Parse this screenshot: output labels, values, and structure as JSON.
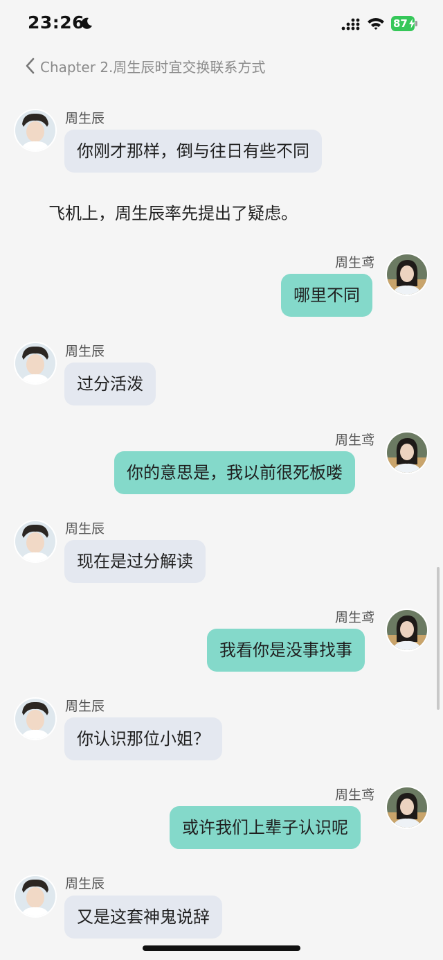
{
  "status_bar": {
    "time": "23:26",
    "battery": "87"
  },
  "nav": {
    "title": "Chapter 2.周生辰时宜交换联系方式"
  },
  "chat": {
    "narration": "飞机上，周生辰率先提出了疑虑。",
    "messages": [
      {
        "sender": "周生辰",
        "side": "left",
        "text": "你刚才那样，倒与往日有些不同"
      },
      {
        "sender": "周生鸢",
        "side": "right",
        "text": "哪里不同"
      },
      {
        "sender": "周生辰",
        "side": "left",
        "text": "过分活泼"
      },
      {
        "sender": "周生鸢",
        "side": "right",
        "text": "你的意思是，我以前很死板喽"
      },
      {
        "sender": "周生辰",
        "side": "left",
        "text": "现在是过分解读"
      },
      {
        "sender": "周生鸢",
        "side": "right",
        "text": "我看你是没事找事"
      },
      {
        "sender": "周生辰",
        "side": "left",
        "text": "你认识那位小姐？"
      },
      {
        "sender": "周生鸢",
        "side": "right",
        "text": "或许我们上辈子认识呢"
      },
      {
        "sender": "周生辰",
        "side": "left",
        "text": "又是这套神鬼说辞"
      }
    ]
  },
  "colors": {
    "background": "#f5f5f5",
    "left_bubble": "#e4e8f0",
    "right_bubble": "#84d9ca",
    "battery": "#35c759"
  }
}
